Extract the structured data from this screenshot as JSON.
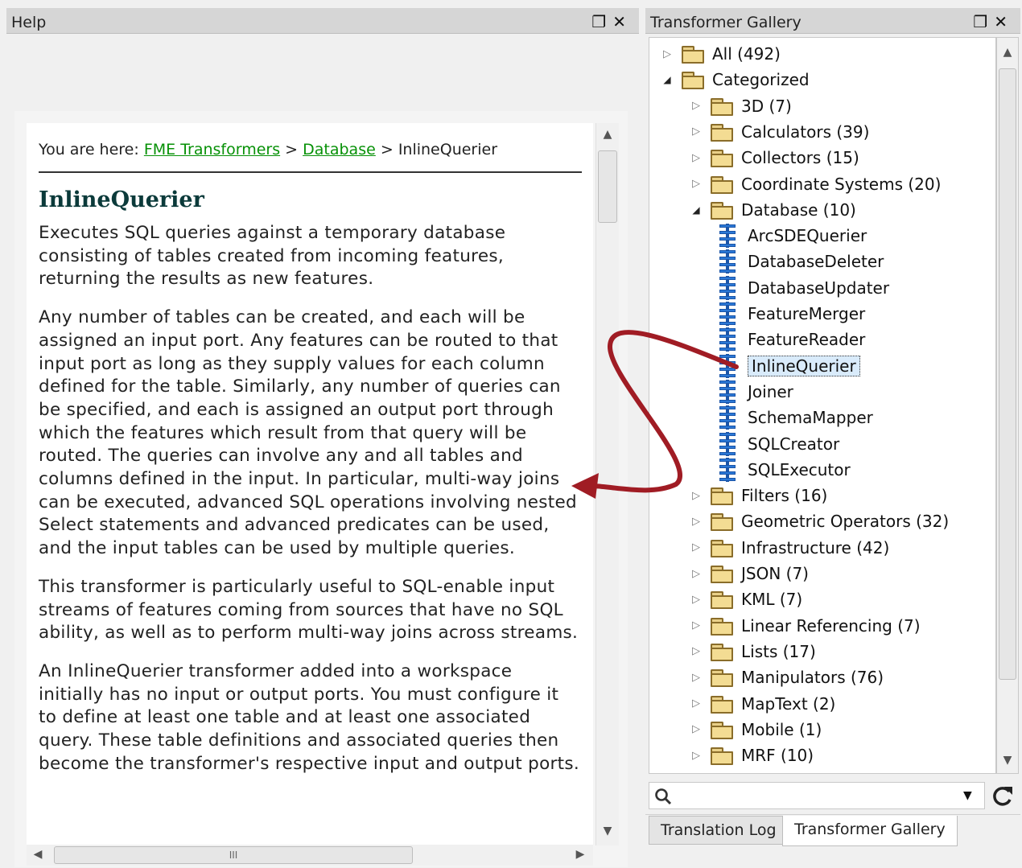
{
  "help_panel": {
    "title": "Help",
    "breadcrumb": {
      "prefix": "You are here:",
      "links": [
        "FME Transformers",
        "Database"
      ],
      "separator": ">",
      "current": "InlineQuerier"
    },
    "heading": "InlineQuerier",
    "paragraphs": [
      "Executes SQL queries against a temporary database consisting of tables created from incoming features, returning the results as new features.",
      "Any number of tables can be created, and each will be assigned an input port. Any features can be routed to that input port as long as they supply values for each column defined for the table. Similarly, any number of queries can be specified, and each is assigned an output port through which the features which result from that query will be routed. The queries can involve any and all tables and columns defined in the input. In particular, multi-way joins can be executed, advanced SQL operations involving nested Select statements and advanced predicates can be used, and the input tables can be used by multiple queries.",
      "This transformer is particularly useful to SQL-enable input streams of features coming from sources that have no SQL ability, as well as to perform multi-way joins across streams.",
      "An InlineQuerier transformer added into a workspace initially has no input or output ports. You must configure it to define at least one table and at least one associated query. These table definitions and associated queries then become the transformer's respective input and output ports."
    ],
    "hscroll_grip": "III"
  },
  "gallery_panel": {
    "title": "Transformer Gallery",
    "tree": [
      {
        "label": "All (492)",
        "level": 0,
        "expanded": false,
        "kind": "folder"
      },
      {
        "label": "Categorized",
        "level": 0,
        "expanded": true,
        "kind": "folder"
      },
      {
        "label": "3D (7)",
        "level": 1,
        "expanded": false,
        "kind": "folder"
      },
      {
        "label": "Calculators (39)",
        "level": 1,
        "expanded": false,
        "kind": "folder"
      },
      {
        "label": "Collectors (15)",
        "level": 1,
        "expanded": false,
        "kind": "folder"
      },
      {
        "label": "Coordinate Systems (20)",
        "level": 1,
        "expanded": false,
        "kind": "folder"
      },
      {
        "label": "Database (10)",
        "level": 1,
        "expanded": true,
        "kind": "folder"
      },
      {
        "label": "ArcSDEQuerier",
        "level": 2,
        "kind": "transformer"
      },
      {
        "label": "DatabaseDeleter",
        "level": 2,
        "kind": "transformer"
      },
      {
        "label": "DatabaseUpdater",
        "level": 2,
        "kind": "transformer"
      },
      {
        "label": "FeatureMerger",
        "level": 2,
        "kind": "transformer"
      },
      {
        "label": "FeatureReader",
        "level": 2,
        "kind": "transformer"
      },
      {
        "label": "InlineQuerier",
        "level": 2,
        "kind": "transformer",
        "selected": true
      },
      {
        "label": "Joiner",
        "level": 2,
        "kind": "transformer"
      },
      {
        "label": "SchemaMapper",
        "level": 2,
        "kind": "transformer"
      },
      {
        "label": "SQLCreator",
        "level": 2,
        "kind": "transformer"
      },
      {
        "label": "SQLExecutor",
        "level": 2,
        "kind": "transformer"
      },
      {
        "label": "Filters (16)",
        "level": 1,
        "expanded": false,
        "kind": "folder"
      },
      {
        "label": "Geometric Operators (32)",
        "level": 1,
        "expanded": false,
        "kind": "folder"
      },
      {
        "label": "Infrastructure (42)",
        "level": 1,
        "expanded": false,
        "kind": "folder"
      },
      {
        "label": "JSON (7)",
        "level": 1,
        "expanded": false,
        "kind": "folder"
      },
      {
        "label": "KML (7)",
        "level": 1,
        "expanded": false,
        "kind": "folder"
      },
      {
        "label": "Linear Referencing (7)",
        "level": 1,
        "expanded": false,
        "kind": "folder"
      },
      {
        "label": "Lists (17)",
        "level": 1,
        "expanded": false,
        "kind": "folder"
      },
      {
        "label": "Manipulators (76)",
        "level": 1,
        "expanded": false,
        "kind": "folder"
      },
      {
        "label": "MapText (2)",
        "level": 1,
        "expanded": false,
        "kind": "folder"
      },
      {
        "label": "Mobile (1)",
        "level": 1,
        "expanded": false,
        "kind": "folder"
      },
      {
        "label": "MRF (10)",
        "level": 1,
        "expanded": false,
        "kind": "folder"
      }
    ],
    "search_placeholder": "",
    "tabs": [
      "Translation Log",
      "Transformer Gallery"
    ],
    "active_tab": "Transformer Gallery"
  },
  "colors": {
    "link_green": "#079107",
    "heading_teal": "#0b3a3a",
    "annotation_red": "#a01c24",
    "selection_bg": "#d9ebfb"
  }
}
